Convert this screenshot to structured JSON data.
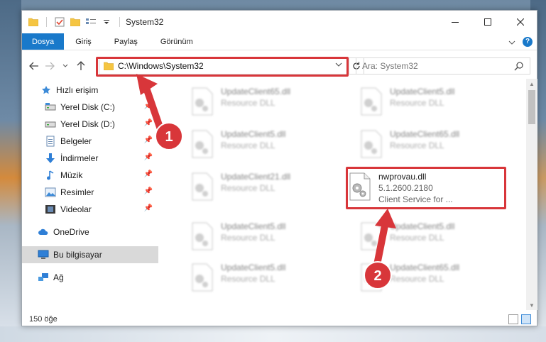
{
  "window": {
    "title": "System32"
  },
  "ribbon": {
    "tabs": [
      {
        "label": "Dosya"
      },
      {
        "label": "Giriş"
      },
      {
        "label": "Paylaş"
      },
      {
        "label": "Görünüm"
      }
    ]
  },
  "address": {
    "path": "C:\\Windows\\System32"
  },
  "search": {
    "placeholder": "Ara: System32"
  },
  "sidebar": {
    "items": [
      {
        "label": "Hızlı erişim",
        "icon": "star-icon"
      },
      {
        "label": "Yerel Disk (C:)",
        "icon": "drive-icon",
        "pinned": true
      },
      {
        "label": "Yerel Disk (D:)",
        "icon": "drive-icon",
        "pinned": true
      },
      {
        "label": "Belgeler",
        "icon": "documents-icon",
        "pinned": true
      },
      {
        "label": "İndirmeler",
        "icon": "download-icon",
        "pinned": true
      },
      {
        "label": "Müzik",
        "icon": "music-icon",
        "pinned": true
      },
      {
        "label": "Resimler",
        "icon": "pictures-icon",
        "pinned": true
      },
      {
        "label": "Videolar",
        "icon": "videos-icon",
        "pinned": true
      },
      {
        "label": "OneDrive",
        "icon": "cloud-icon"
      },
      {
        "label": "Bu bilgisayar",
        "icon": "computer-icon",
        "selected": true
      },
      {
        "label": "Ağ",
        "icon": "network-icon"
      }
    ]
  },
  "files": [
    {
      "name": "UpdateClient65.dll",
      "sub": "Resource DLL",
      "blurred": true
    },
    {
      "name": "UpdateClient5.dll",
      "sub": "Resource DLL",
      "blurred": true
    },
    {
      "name": "UpdateClient5.dll",
      "sub": "Resource DLL",
      "blurred": true
    },
    {
      "name": "UpdateClient65.dll",
      "sub": "Resource DLL",
      "blurred": true
    },
    {
      "name": "UpdateClient21.dll",
      "sub": "Resource DLL",
      "blurred": true
    },
    {
      "name": "nwprovau.dll",
      "sub": "5.1.2600.2180",
      "sub2": "Client Service for ...",
      "blurred": false
    },
    {
      "name": "UpdateClient5.dll",
      "sub": "Resource DLL",
      "blurred": true
    },
    {
      "name": "UpdateClient5.dll",
      "sub": "Resource DLL",
      "blurred": true
    },
    {
      "name": "UpdateClient5.dll",
      "sub": "Resource DLL",
      "blurred": true
    },
    {
      "name": "UpdateClient65.dll",
      "sub": "Resource DLL",
      "blurred": true
    }
  ],
  "status": {
    "count": "150 öğe"
  },
  "callouts": {
    "one": "1",
    "two": "2"
  },
  "colors": {
    "accent": "#1979ca",
    "highlight": "#d8363a",
    "selected": "#d9d9d9"
  }
}
